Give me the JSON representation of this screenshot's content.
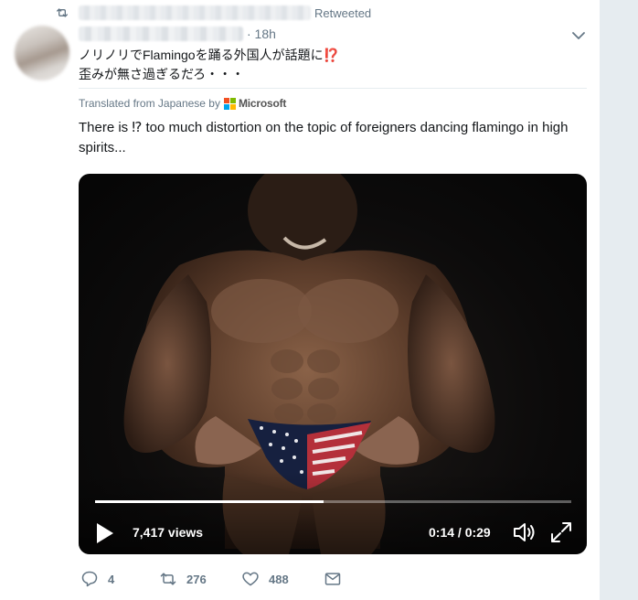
{
  "retweet_header": {
    "label": "Retweeted"
  },
  "tweet": {
    "timestamp": "· 18h",
    "text_ja_line1_prefix": "ノリノリでFlamingoを踊る外国人が話題に",
    "text_ja_line1_emoji": "⁉️",
    "text_ja_line2": "歪みが無さ過ぎるだろ・・・",
    "translated_from": "Translated from Japanese by",
    "translator": "Microsoft",
    "translation": "There is ⁉ too much distortion on the topic of foreigners dancing flamingo in high spirits..."
  },
  "video": {
    "views": "7,417 views",
    "time": "0:14 / 0:29",
    "progress_fraction": 0.48
  },
  "actions": {
    "reply_count": "4",
    "retweet_count": "276",
    "like_count": "488"
  },
  "colors": {
    "accent_red": "#e0245e",
    "secondary_text": "#657786",
    "page_bg": "#e6ecf0"
  },
  "icons": [
    "retweet-icon",
    "caret-down-icon",
    "microsoft-logo",
    "play-icon",
    "volume-icon",
    "fullscreen-icon",
    "reply-icon",
    "like-icon",
    "direct-message-icon"
  ]
}
